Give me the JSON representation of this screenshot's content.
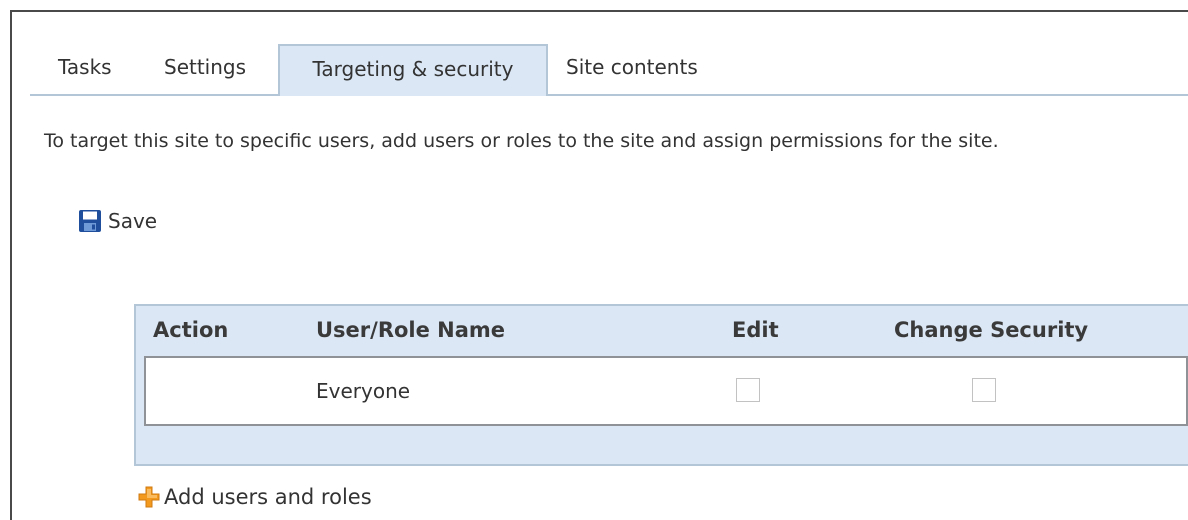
{
  "tabs": [
    {
      "label": "Tasks"
    },
    {
      "label": "Settings"
    },
    {
      "label": "Targeting & security",
      "active": true
    },
    {
      "label": "Site contents"
    }
  ],
  "description": "To target this site to specific users, add users or roles to the site and assign permissions for the site.",
  "toolbar": {
    "save_label": "Save",
    "save_icon": "floppy-disk-icon"
  },
  "table": {
    "headers": [
      "Action",
      "User/Role Name",
      "Edit",
      "Change Security"
    ],
    "rows": [
      {
        "action": "",
        "name": "Everyone",
        "edit": false,
        "change_security": false
      }
    ]
  },
  "add": {
    "label": "Add users and roles",
    "icon": "plus-icon"
  },
  "colors": {
    "panel_bg": "#dbe7f5",
    "panel_border": "#b3c6d8",
    "plus_orange": "#f39a1e",
    "save_blue": "#1f4e9c"
  }
}
